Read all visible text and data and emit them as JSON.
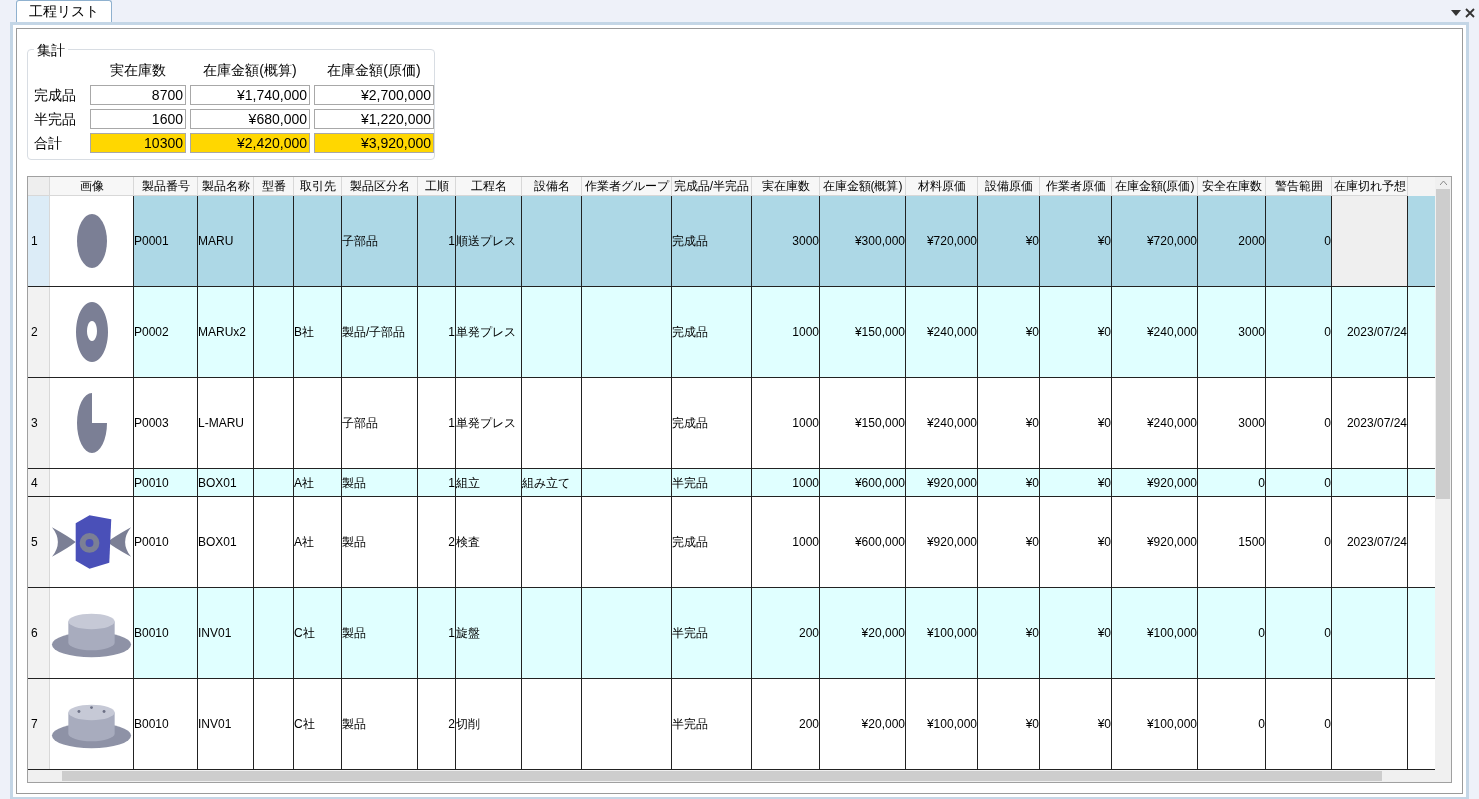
{
  "tab": {
    "label": "工程リスト",
    "selected": true
  },
  "summary": {
    "title": "集計",
    "columns": [
      "実在庫数",
      "在庫金額(概算)",
      "在庫金額(原価)"
    ],
    "rows": [
      {
        "label": "完成品",
        "kind": "normal",
        "values": [
          "8700",
          "¥1,740,000",
          "¥2,700,000"
        ]
      },
      {
        "label": "半完品",
        "kind": "normal",
        "values": [
          "1600",
          "¥680,000",
          "¥1,220,000"
        ]
      },
      {
        "label": "合計",
        "kind": "total",
        "values": [
          "10300",
          "¥2,420,000",
          "¥3,920,000"
        ]
      }
    ]
  },
  "table": {
    "columns": [
      {
        "label": "画像",
        "kind": "image"
      },
      {
        "label": "製品番号",
        "kind": "text"
      },
      {
        "label": "製品名称",
        "kind": "text"
      },
      {
        "label": "型番",
        "kind": "text"
      },
      {
        "label": "取引先",
        "kind": "text"
      },
      {
        "label": "製品区分名",
        "kind": "text"
      },
      {
        "label": "工順",
        "kind": "number"
      },
      {
        "label": "工程名",
        "kind": "text"
      },
      {
        "label": "設備名",
        "kind": "text"
      },
      {
        "label": "作業者グループ",
        "kind": "text"
      },
      {
        "label": "完成品/半完品",
        "kind": "text"
      },
      {
        "label": "実在庫数",
        "kind": "number"
      },
      {
        "label": "在庫金額(概算)",
        "kind": "number"
      },
      {
        "label": "材料原価",
        "kind": "number"
      },
      {
        "label": "設備原価",
        "kind": "number"
      },
      {
        "label": "作業者原価",
        "kind": "number"
      },
      {
        "label": "在庫金額(原価)",
        "kind": "number"
      },
      {
        "label": "安全在庫数",
        "kind": "number"
      },
      {
        "label": "警告範囲",
        "kind": "number"
      },
      {
        "label": "在庫切れ予想",
        "kind": "number"
      }
    ],
    "rows": [
      {
        "number": "1",
        "selected": true,
        "kind": "disc",
        "cells": [
          null,
          "P0001",
          "MARU",
          null,
          null,
          "子部品",
          "1",
          "順送プレス",
          null,
          null,
          "完成品",
          "3000",
          "¥300,000",
          "¥720,000",
          "¥0",
          "¥0",
          "¥720,000",
          "2000",
          "0",
          null
        ]
      },
      {
        "number": "2",
        "selected": false,
        "kind": "ring",
        "cells": [
          null,
          "P0002",
          "MARUx2",
          null,
          "B社",
          "製品/子部品",
          "1",
          "単発プレス",
          null,
          null,
          "完成品",
          "1000",
          "¥150,000",
          "¥240,000",
          "¥0",
          "¥0",
          "¥240,000",
          "3000",
          "0",
          "2023/07/24"
        ]
      },
      {
        "number": "3",
        "selected": false,
        "kind": "pie",
        "cells": [
          null,
          "P0003",
          "L-MARU",
          null,
          null,
          "子部品",
          "1",
          "単発プレス",
          null,
          null,
          "完成品",
          "1000",
          "¥150,000",
          "¥240,000",
          "¥0",
          "¥0",
          "¥240,000",
          "3000",
          "0",
          "2023/07/24"
        ]
      },
      {
        "number": "4",
        "selected": false,
        "kind": "plain",
        "cells": [
          null,
          "P0010",
          "BOX01",
          null,
          "A社",
          "製品",
          "1",
          "組立",
          "組み立て",
          null,
          "半完品",
          "1000",
          "¥600,000",
          "¥920,000",
          "¥0",
          "¥0",
          "¥920,000",
          "0",
          "0",
          null
        ]
      },
      {
        "number": "5",
        "selected": false,
        "kind": "box",
        "cells": [
          null,
          "P0010",
          "BOX01",
          null,
          "A社",
          "製品",
          "2",
          "検査",
          null,
          null,
          "完成品",
          "1000",
          "¥600,000",
          "¥920,000",
          "¥0",
          "¥0",
          "¥920,000",
          "1500",
          "0",
          "2023/07/24"
        ]
      },
      {
        "number": "6",
        "selected": false,
        "kind": "hat",
        "cells": [
          null,
          "B0010",
          "INV01",
          null,
          "C社",
          "製品",
          "1",
          "旋盤",
          null,
          null,
          "半完品",
          "200",
          "¥20,000",
          "¥100,000",
          "¥0",
          "¥0",
          "¥100,000",
          "0",
          "0",
          null
        ]
      },
      {
        "number": "7",
        "selected": false,
        "kind": "drilled",
        "cells": [
          null,
          "B0010",
          "INV01",
          null,
          "C社",
          "製品",
          "2",
          "切削",
          null,
          null,
          "半完品",
          "200",
          "¥20,000",
          "¥100,000",
          "¥0",
          "¥0",
          "¥100,000",
          "0",
          "0",
          null
        ]
      }
    ]
  }
}
